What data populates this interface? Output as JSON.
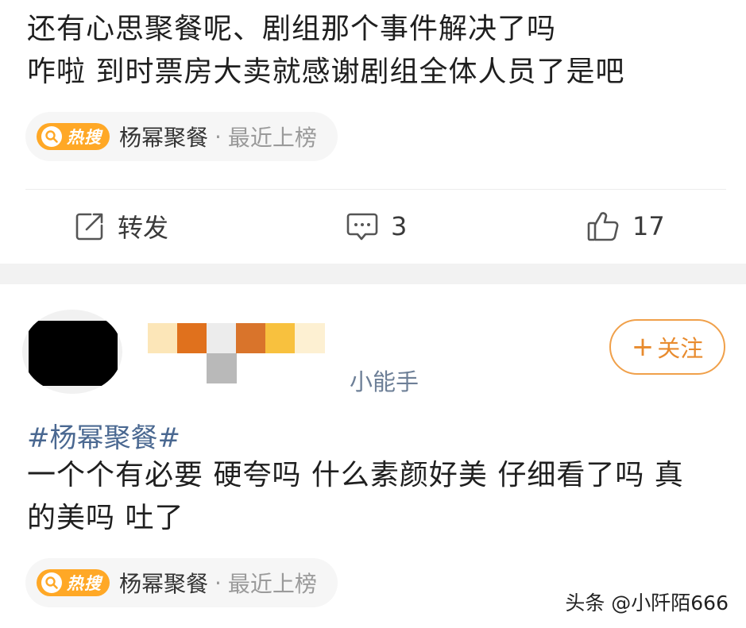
{
  "post1": {
    "text_line1": "还有心思聚餐呢、剧组那个事件解决了吗",
    "text_line2": "咋啦 到时票房大卖就感谢剧组全体人员了是吧",
    "trend": {
      "badge": "热搜",
      "badge_icon": "search-icon",
      "topic": "杨幂聚餐",
      "separator": "·",
      "status": "最近上榜"
    },
    "actions": {
      "repost_label": "转发",
      "repost_icon": "share-icon",
      "comment_count": "3",
      "comment_icon": "comment-icon",
      "like_count": "17",
      "like_icon": "thumbs-up-icon"
    }
  },
  "post2": {
    "source_label": "小能手",
    "follow_label": "关注",
    "follow_symbol": "+",
    "hashtag": "#杨幂聚餐#",
    "text_line1": "一个个有必要 硬夸吗 什么素颜好美 仔细看了吗 真",
    "text_line2": "的美吗 吐了",
    "trend": {
      "badge": "热搜",
      "badge_icon": "search-icon",
      "topic": "杨幂聚餐",
      "separator": "·",
      "status": "最近上榜"
    }
  },
  "watermark": "头条 @小阡陌666",
  "colors": {
    "accent_orange": "#ffa826",
    "follow_orange": "#e88b2e",
    "link_blue": "#4a6891",
    "muted_gray": "#9a9a9a"
  }
}
